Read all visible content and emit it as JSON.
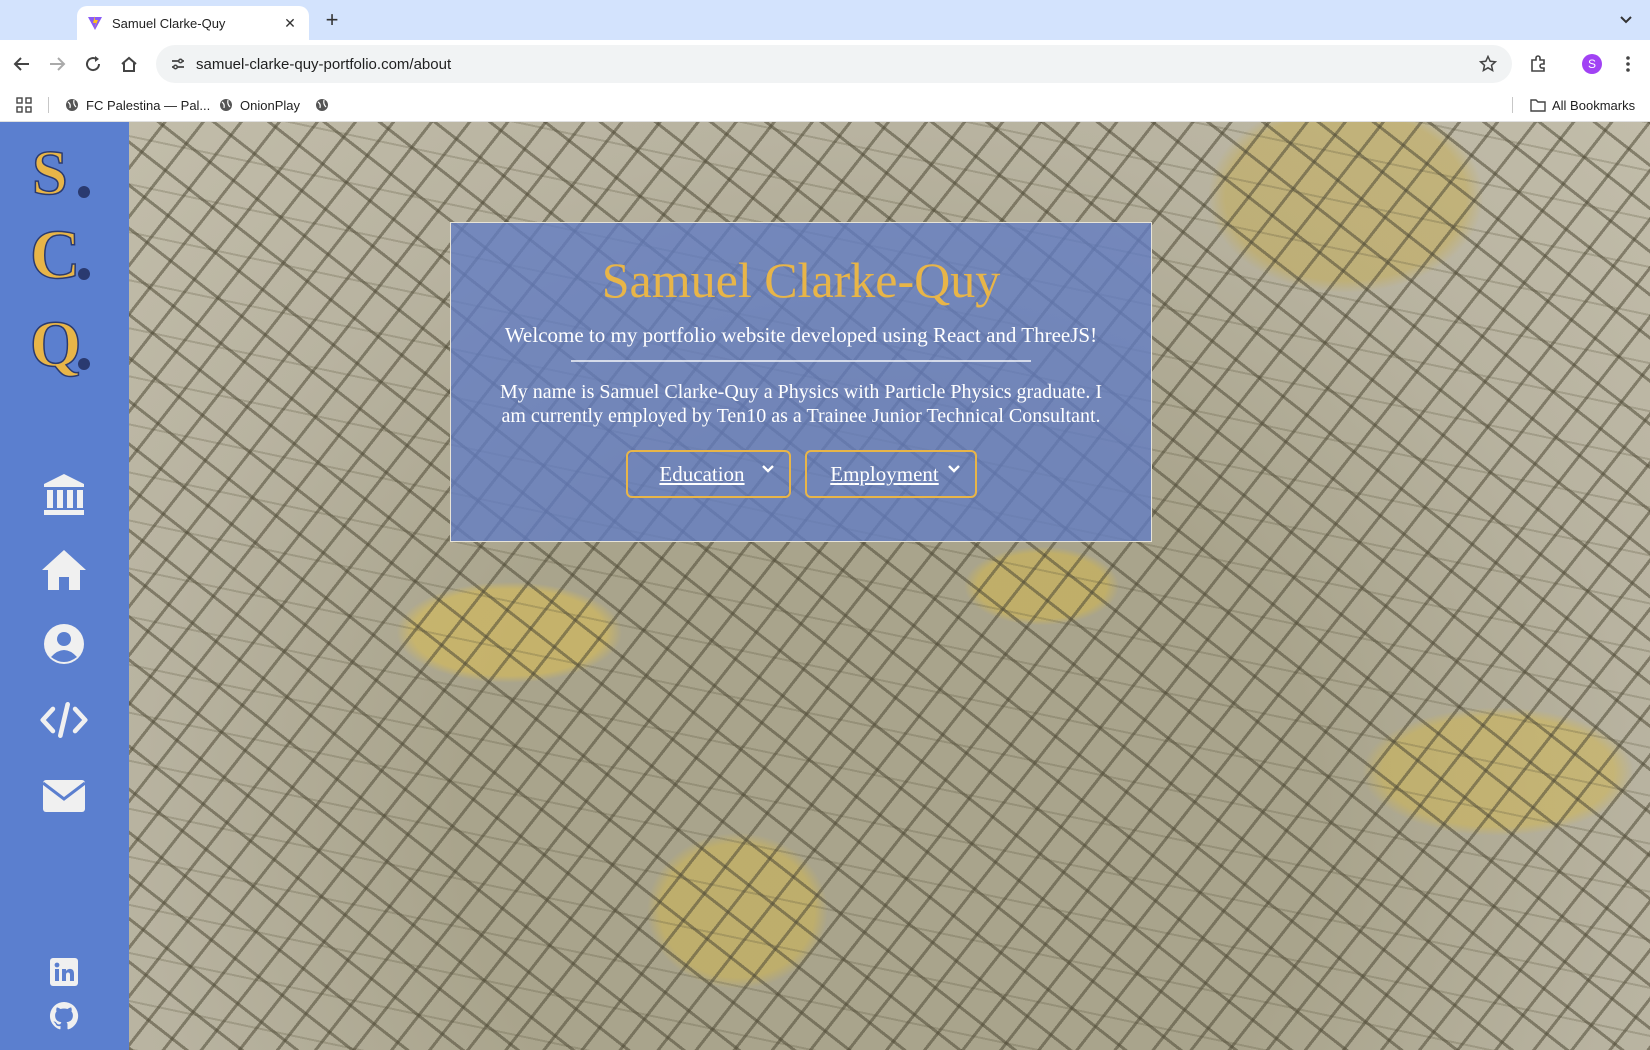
{
  "browser": {
    "tab": {
      "title": "Samuel Clarke-Quy"
    },
    "omnibox": {
      "url": "samuel-clarke-quy-portfolio.com/about"
    },
    "profile": {
      "initial": "S"
    },
    "bookmarks": [
      {
        "label": "FC Palestina — Pal..."
      },
      {
        "label": "OnionPlay"
      },
      {
        "label": ""
      }
    ],
    "all_bookmarks_label": "All Bookmarks"
  },
  "sidebar": {
    "logos": [
      "S",
      "C",
      "Q"
    ],
    "nav_icons": [
      "institution-icon",
      "home-icon",
      "user-icon",
      "code-icon",
      "mail-icon"
    ],
    "social_icons": [
      "linkedin-icon",
      "github-icon"
    ]
  },
  "card": {
    "title": "Samuel Clarke-Quy",
    "welcome": "Welcome to my portfolio website developed using React and ThreeJS!",
    "bio": "My name is Samuel Clarke-Quy a Physics with Particle Physics graduate. I am currently employed by Ten10 as a Trainee Junior Technical Consultant.",
    "buttons": {
      "education": "Education",
      "employment": "Employment"
    }
  },
  "colors": {
    "sidebar": "#5b7fcf",
    "accent_gold": "#e8b548",
    "card_bg": "#627cc4"
  }
}
